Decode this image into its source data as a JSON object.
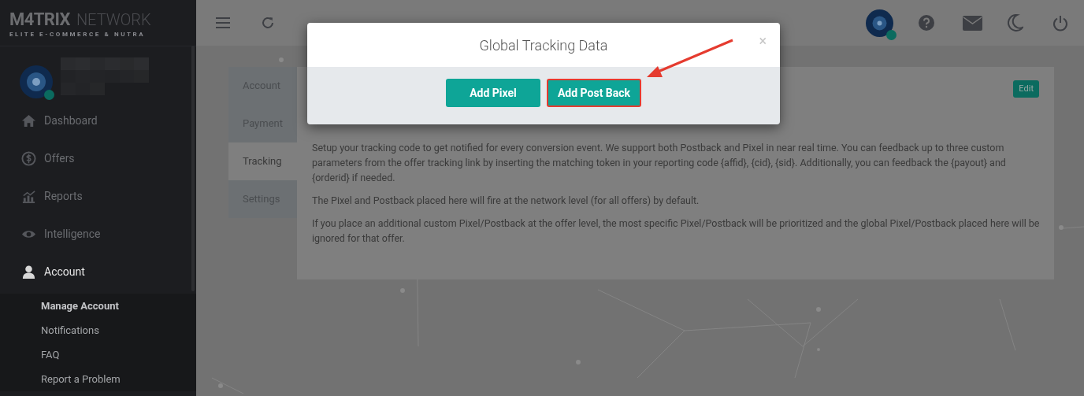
{
  "brand": {
    "name": "M4TRIX",
    "suffix": "NETWORK",
    "tagline": "ELITE E-COMMERCE & NUTRA"
  },
  "user": {
    "online": true
  },
  "sidebar": {
    "items": [
      {
        "label": "Dashboard",
        "selected": false
      },
      {
        "label": "Offers",
        "selected": false
      },
      {
        "label": "Reports",
        "selected": false
      },
      {
        "label": "Intelligence",
        "selected": false
      },
      {
        "label": "Account",
        "selected": true
      }
    ],
    "subitems": [
      {
        "label": "Manage Account",
        "selected": true
      },
      {
        "label": "Notifications",
        "selected": false
      },
      {
        "label": "FAQ",
        "selected": false
      },
      {
        "label": "Report a Problem",
        "selected": false
      }
    ]
  },
  "tabs": [
    {
      "label": "Account",
      "selected": false
    },
    {
      "label": "Payment",
      "selected": false
    },
    {
      "label": "Tracking",
      "selected": true
    },
    {
      "label": "Settings",
      "selected": false
    }
  ],
  "card": {
    "edit": "Edit",
    "paragraphs": [
      "Setup your tracking code to get notified for every conversion event. We support both Postback and Pixel in near real time. You can feedback up to three custom parameters from the offer tracking link by inserting the matching token in your reporting code {affid}, {cid}, {sid}. Additionally, you can feedback the {payout} and {orderid} if needed.",
      "The Pixel and Postback placed here will fire at the network level (for all offers) by default.",
      "If you place an additional custom Pixel/Postback at the offer level, the most specific Pixel/Postback will be prioritized and the global Pixel/Postback placed here will be ignored for that offer."
    ]
  },
  "modal": {
    "title": "Global Tracking Data",
    "close": "×",
    "buttons": [
      {
        "label": "Add Pixel",
        "highlighted": false
      },
      {
        "label": "Add Post Back",
        "highlighted": true
      }
    ]
  }
}
